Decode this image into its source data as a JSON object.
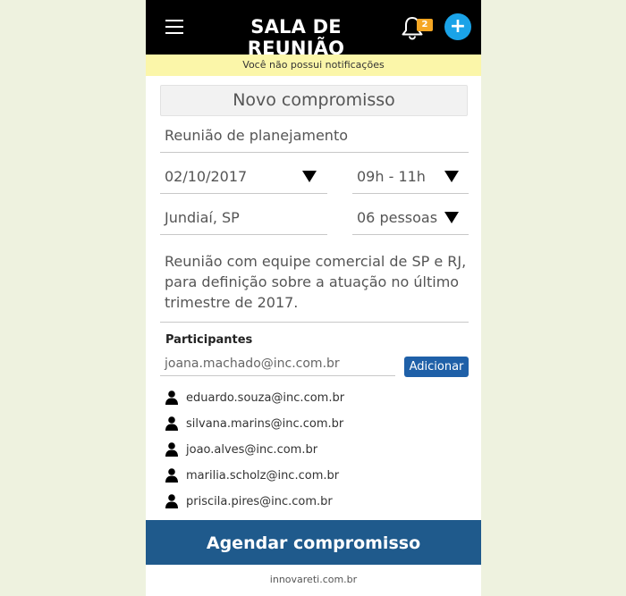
{
  "appbar": {
    "title": "SALA DE REUNIÃO",
    "notification_count": "2",
    "add_label": "+",
    "icons": [
      "menu-icon",
      "bell-icon",
      "plus-icon"
    ],
    "accent_color": "#1aa3e8",
    "badge_color": "#f5a623"
  },
  "notice": {
    "text": "Você não possui notificações",
    "background": "#fbf6a9"
  },
  "form": {
    "title": "Novo compromisso",
    "meeting_name": "Reunião de planejamento",
    "date": "02/10/2017",
    "time": "09h - 11h",
    "location": "Jundiaí, SP",
    "people": "06 pessoas",
    "description_lines": [
      "Reunião com equipe comercial de SP e RJ,",
      "para definição sobre a atuação no último",
      "trimestre de 2017."
    ]
  },
  "participants": {
    "label": "Participantes",
    "input_value": "joana.machado@inc.com.br",
    "add_button": "Adicionar",
    "list": [
      "eduardo.souza@inc.com.br",
      "silvana.marins@inc.com.br",
      "joao.alves@inc.com.br",
      "marilia.scholz@inc.com.br",
      "priscila.pires@inc.com.br"
    ]
  },
  "cta": {
    "label": "Agendar compromisso",
    "color": "#1f5a8c"
  },
  "footer": {
    "text": "innovareti.com.br"
  }
}
